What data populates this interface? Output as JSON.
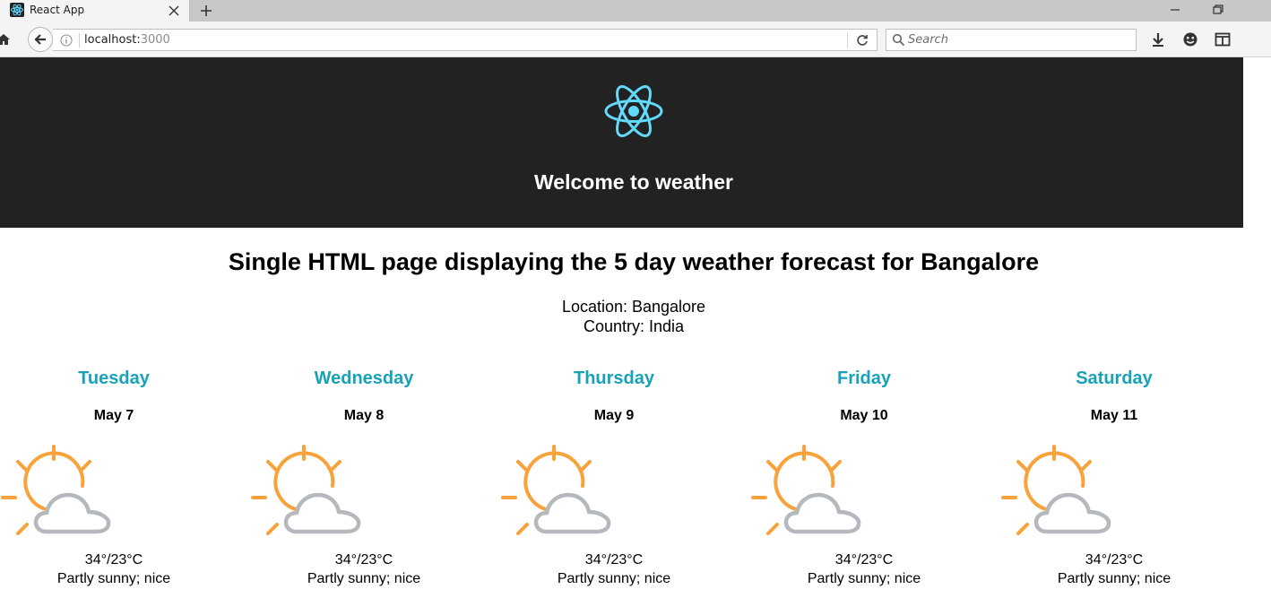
{
  "browser": {
    "tab_title": "React App",
    "url_host": "localhost:",
    "url_port": "3000",
    "search_placeholder": "Search"
  },
  "header": {
    "title": "Welcome to weather",
    "logo_color": "#61dafb"
  },
  "main": {
    "heading": "Single HTML page displaying the 5 day weather forecast for Bangalore",
    "location": "Location: Bangalore",
    "country": "Country: India"
  },
  "forecast": [
    {
      "day": "Tuesday",
      "date": "May 7",
      "temp": "34°/23°C",
      "summary": "Partly sunny; nice",
      "icon": "partly-sunny-icon"
    },
    {
      "day": "Wednesday",
      "date": "May 8",
      "temp": "34°/23°C",
      "summary": "Partly sunny; nice",
      "icon": "partly-sunny-icon"
    },
    {
      "day": "Thursday",
      "date": "May 9",
      "temp": "34°/23°C",
      "summary": "Partly sunny; nice",
      "icon": "partly-sunny-icon"
    },
    {
      "day": "Friday",
      "date": "May 10",
      "temp": "34°/23°C",
      "summary": "Partly sunny; nice",
      "icon": "partly-sunny-icon"
    },
    {
      "day": "Saturday",
      "date": "May 11",
      "temp": "34°/23°C",
      "summary": "Partly sunny; nice",
      "icon": "partly-sunny-icon"
    }
  ],
  "colors": {
    "day_name": "#17a2b8",
    "header_bg": "#222222",
    "sun": "#f7a23a",
    "cloud": "#b5b8bc"
  }
}
